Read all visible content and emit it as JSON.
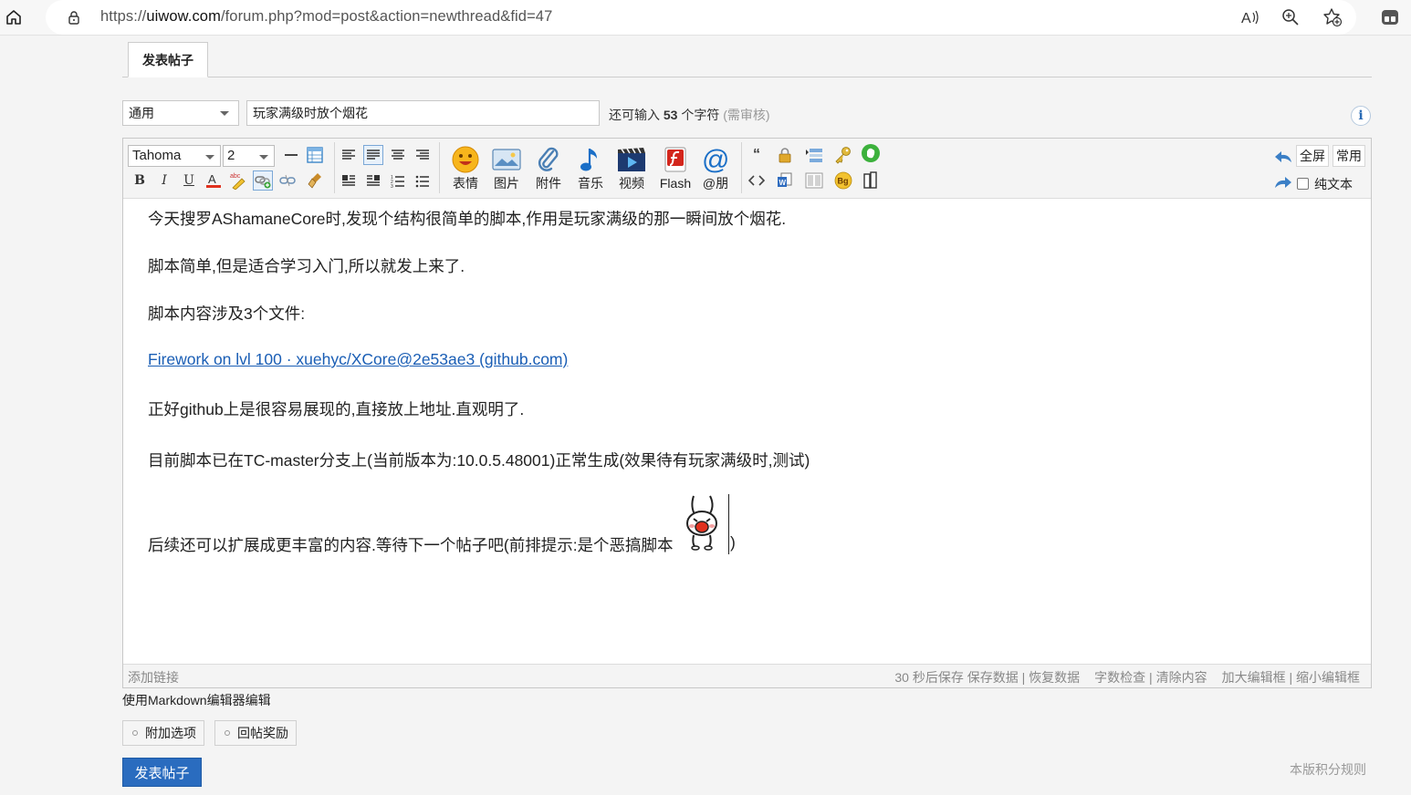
{
  "browser": {
    "url_scheme": "https://",
    "url_host": "uiwow.com",
    "url_rest": "/forum.php?mod=post&action=newthread&fid=47",
    "icons": [
      "home-icon",
      "lock-icon",
      "read-aloud-icon",
      "zoom-icon",
      "favorite-icon",
      "collections-icon"
    ]
  },
  "tab": {
    "label": "发表帖子"
  },
  "subject": {
    "type_value": "通用",
    "title_value": "玩家满级时放个烟花",
    "hint_prefix": "还可输入",
    "hint_count": "53",
    "hint_suffix": "个字符",
    "hint_review": "(需审核)"
  },
  "toolbar": {
    "font": "Tahoma",
    "size": "2",
    "emoji": "表情",
    "image": "图片",
    "attach": "附件",
    "music": "音乐",
    "video": "视频",
    "flash": "Flash",
    "at": "@朋",
    "fullscreen": "全屏",
    "common": "常用",
    "plaintext": "纯文本"
  },
  "content": {
    "p1": "今天搜罗AShamaneCore时,发现个结构很简单的脚本,作用是玩家满级的那一瞬间放个烟花.",
    "p2": "脚本简单,但是适合学习入门,所以就发上来了.",
    "p3": "脚本内容涉及3个文件:",
    "link": "Firework on lvl 100 · xuehyc/XCore@2e53ae3 (github.com)",
    "p4": "正好github上是很容易展现的,直接放上地址.直观明了.",
    "p5": "目前脚本已在TC-master分支上(当前版本为:10.0.5.48001)正常生成(效果待有玩家满级时,测试)",
    "p6": "后续还可以扩展成更丰富的内容.等待下一个帖子吧(前排提示:是个恶搞脚本",
    "p6_end": ")"
  },
  "statusbar": {
    "add_link": "添加链接",
    "autosave": "30 秒后保存 保存数据 | 恢复数据",
    "wordcheck": "字数检查 | 清除内容",
    "resize": "加大编辑框 | 缩小编辑框"
  },
  "below": {
    "markdown": "使用Markdown编辑器编辑",
    "extra_options": "附加选项",
    "reply_reward": "回帖奖励",
    "submit": "发表帖子",
    "rules": "本版积分规则"
  }
}
